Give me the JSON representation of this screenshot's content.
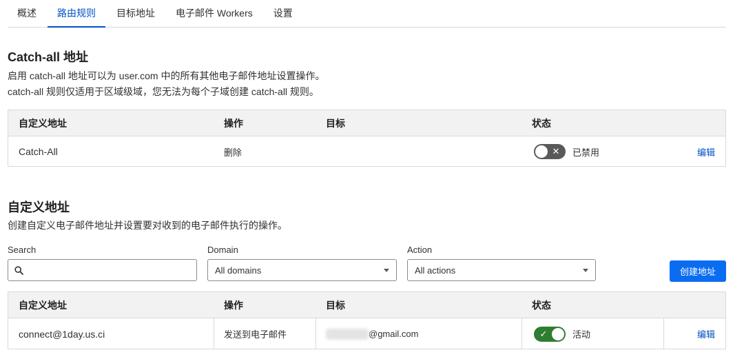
{
  "tabs": [
    {
      "label": "概述"
    },
    {
      "label": "路由规则"
    },
    {
      "label": "目标地址"
    },
    {
      "label": "电子邮件 Workers"
    },
    {
      "label": "设置"
    }
  ],
  "catchall": {
    "title": "Catch-all 地址",
    "desc_line1": "启用 catch-all 地址可以为 user.com 中的所有其他电子邮件地址设置操作。",
    "desc_line2": "catch-all 规则仅适用于区域级域，您无法为每个子域创建 catch-all 规则。",
    "headers": {
      "address": "自定义地址",
      "action": "操作",
      "target": "目标",
      "status": "状态"
    },
    "row": {
      "address": "Catch-All",
      "action": "删除",
      "target": "",
      "status_label": "已禁用",
      "status_on": false,
      "edit": "编辑"
    }
  },
  "custom": {
    "title": "自定义地址",
    "desc": "创建自定义电子邮件地址并设置要对收到的电子邮件执行的操作。",
    "search_label": "Search",
    "search_placeholder": "",
    "domain_label": "Domain",
    "domain_value": "All domains",
    "action_label": "Action",
    "action_value": "All actions",
    "create_button": "创建地址",
    "headers": {
      "address": "自定义地址",
      "action": "操作",
      "target": "目标",
      "status": "状态"
    },
    "row": {
      "address": "connect@1day.us.ci",
      "action": "发送到电子邮件",
      "target_visible": "@gmail.com",
      "status_label": "活动",
      "status_on": true,
      "edit": "编辑"
    }
  },
  "colors": {
    "accent": "#0051c3",
    "primary_button": "#0a6cf0",
    "toggle_on": "#2f7d31",
    "toggle_off": "#595959"
  }
}
